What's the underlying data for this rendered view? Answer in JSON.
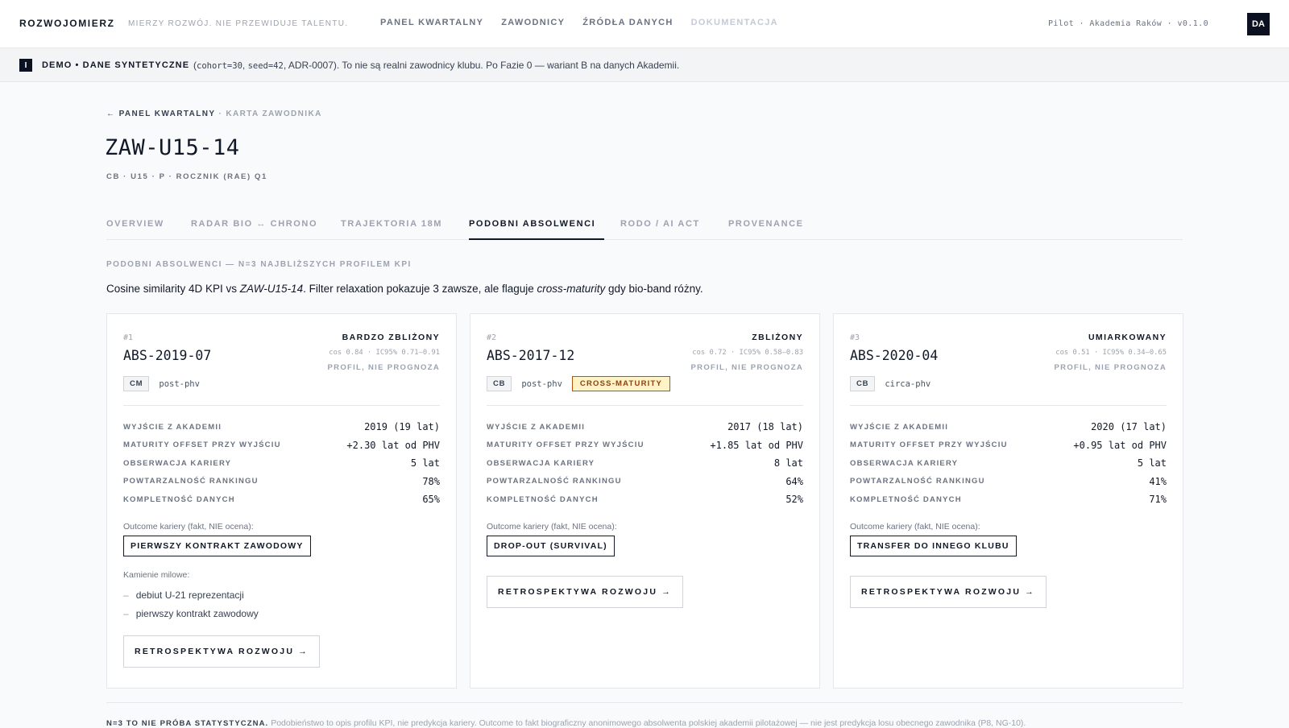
{
  "header": {
    "brand": "ROZWOJOMIERZ",
    "tagline": "MIERZY ROZWÓJ. NIE PRZEWIDUJE TALENTU.",
    "nav": [
      "PANEL KWARTALNY",
      "ZAWODNICY",
      "ŹRÓDŁA DANYCH",
      "DOKUMENTACJA"
    ],
    "pilot": "Pilot · Akademia Raków · v0.1.0",
    "avatar": "DA"
  },
  "banner": {
    "icon": "I",
    "strong": "DEMO • DANE SYNTETYCZNE",
    "text_prefix": "(",
    "mono_a": "cohort=30",
    "sep_a": ", ",
    "mono_b": "seed=42",
    "text_rest": ", ADR-0007). To nie są realni zawodnicy klubu. Po Fazie 0 — wariant B na danych Akademii."
  },
  "breadcrumb": {
    "back": "← PANEL KWARTALNY",
    "sep": " · ",
    "current": "KARTA ZAWODNIKA"
  },
  "player": {
    "id": "ZAW-U15-14",
    "meta": "CB · U15 · P · ROCZNIK (RAE) Q1"
  },
  "tabs": [
    "OVERVIEW",
    "RADAR BIO ↔ CHRONO",
    "TRAJEKTORIA 18M",
    "PODOBNI ABSOLWENCI",
    "RODO / AI ACT",
    "PROVENANCE"
  ],
  "section": {
    "label": "PODOBNI ABSOLWENCI — N=3 NAJBLIŻSZYCH PROFILEM KPI",
    "intro_a": "Cosine similarity 4D KPI vs ",
    "intro_b": "ZAW-U15-14",
    "intro_c": ". Filter relaxation pokazuje 3 zawsze, ale flaguje ",
    "intro_d": "cross-maturity",
    "intro_e": " gdy bio-band różny."
  },
  "cards": [
    {
      "rank": "#1",
      "id": "ABS-2019-07",
      "similarity": "BARDZO ZBLIŻONY",
      "cos": "cos 0.84 · IC95% 0.71–0.91",
      "profil": "PROFIL, NIE PROGNOZA",
      "position": "CM",
      "band": "post-phv",
      "stats": [
        {
          "k": "WYJŚCIE Z AKADEMII",
          "v": "2019 (19 lat)"
        },
        {
          "k": "MATURITY OFFSET PRZY WYJŚCIU",
          "v": "+2.30 lat od PHV"
        },
        {
          "k": "OBSERWACJA KARIERY",
          "v": "5 lat"
        },
        {
          "k": "POWTARZALNOŚĆ RANKINGU",
          "v": "78%"
        },
        {
          "k": "KOMPLETNOŚĆ DANYCH",
          "v": "65%"
        }
      ],
      "outcome_label": "Outcome kariery (fakt, NIE ocena):",
      "outcome": "PIERWSZY KONTRAKT ZAWODOWY",
      "milestones_label": "Kamienie milowe:",
      "milestones": [
        "debiut U-21 reprezentacji",
        "pierwszy kontrakt zawodowy"
      ],
      "retro": "RETROSPEKTYWA ROZWOJU →"
    },
    {
      "rank": "#2",
      "id": "ABS-2017-12",
      "similarity": "ZBLIŻONY",
      "cos": "cos 0.72 · IC95% 0.58–0.83",
      "profil": "PROFIL, NIE PROGNOZA",
      "position": "CB",
      "band": "post-phv",
      "flag": "CROSS-MATURITY",
      "stats": [
        {
          "k": "WYJŚCIE Z AKADEMII",
          "v": "2017 (18 lat)"
        },
        {
          "k": "MATURITY OFFSET PRZY WYJŚCIU",
          "v": "+1.85 lat od PHV"
        },
        {
          "k": "OBSERWACJA KARIERY",
          "v": "8 lat"
        },
        {
          "k": "POWTARZALNOŚĆ RANKINGU",
          "v": "64%"
        },
        {
          "k": "KOMPLETNOŚĆ DANYCH",
          "v": "52%"
        }
      ],
      "outcome_label": "Outcome kariery (fakt, NIE ocena):",
      "outcome": "DROP-OUT (SURVIVAL)",
      "retro": "RETROSPEKTYWA ROZWOJU →"
    },
    {
      "rank": "#3",
      "id": "ABS-2020-04",
      "similarity": "UMIARKOWANY",
      "cos": "cos 0.51 · IC95% 0.34–0.65",
      "profil": "PROFIL, NIE PROGNOZA",
      "position": "CB",
      "band": "circa-phv",
      "stats": [
        {
          "k": "WYJŚCIE Z AKADEMII",
          "v": "2020 (17 lat)"
        },
        {
          "k": "MATURITY OFFSET PRZY WYJŚCIU",
          "v": "+0.95 lat od PHV"
        },
        {
          "k": "OBSERWACJA KARIERY",
          "v": "5 lat"
        },
        {
          "k": "POWTARZALNOŚĆ RANKINGU",
          "v": "41%"
        },
        {
          "k": "KOMPLETNOŚĆ DANYCH",
          "v": "71%"
        }
      ],
      "outcome_label": "Outcome kariery (fakt, NIE ocena):",
      "outcome": "TRANSFER DO INNEGO KLUBU",
      "retro": "RETROSPEKTYWA ROZWOJU →"
    }
  ],
  "footer": {
    "strong": "N=3 TO NIE PRÓBA STATYSTYCZNA.",
    "text": "Podobieństwo to opis profilu KPI, nie predykcja kariery. Outcome to fakt biograficzny anonimowego absolwenta polskiej akademii pilotażowej — nie jest predykcja losu obecnego zawodnika (P8, NG-10)."
  }
}
